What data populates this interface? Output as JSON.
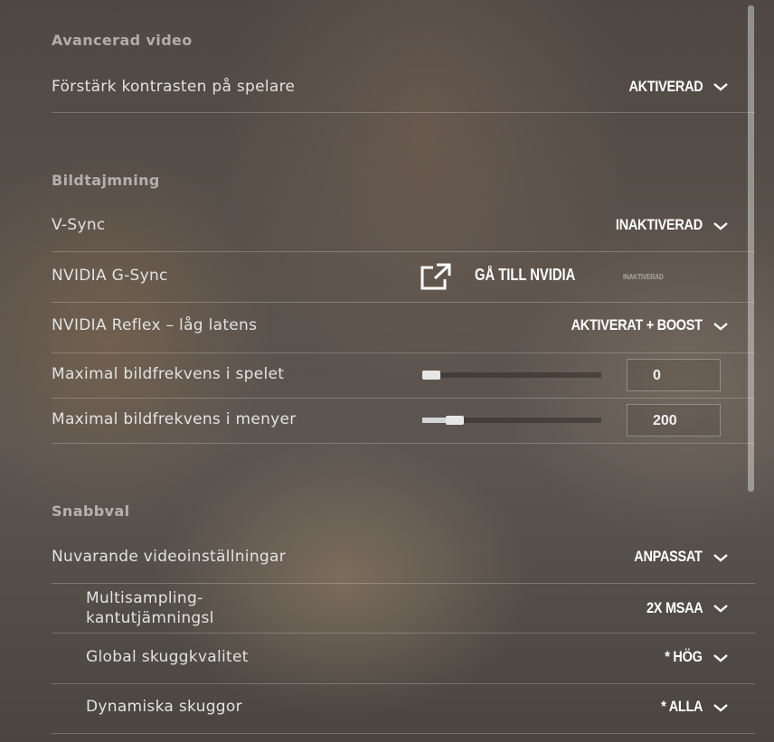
{
  "sections": {
    "advanced_video": "Avancerad video",
    "frame_timing": "Bildtajmning",
    "quick_select": "Snabbval"
  },
  "rows": {
    "contrast": {
      "label": "Förstärk kontrasten på spelare",
      "value": "AKTIVERAD"
    },
    "vsync": {
      "label": "V-Sync",
      "value": "INAKTIVERAD"
    },
    "gsync": {
      "label": "NVIDIA G-Sync",
      "link": "GÅ TILL NVIDIA",
      "status": "INAKTIVERAD"
    },
    "reflex": {
      "label": "NVIDIA Reflex – låg latens",
      "value": "AKTIVERAT + BOOST"
    },
    "max_fps_game": {
      "label": "Maximal bildfrekvens i spelet",
      "value": "0",
      "slider_fraction": 0.0
    },
    "max_fps_menu": {
      "label": "Maximal bildfrekvens i menyer",
      "value": "200",
      "slider_fraction": 0.2
    },
    "current_video": {
      "label": "Nuvarande videoinställningar",
      "value": "ANPASSAT"
    },
    "msaa": {
      "label_line1": "Multisampling-",
      "label_line2": "kantutjämningsl",
      "value": "2X MSAA"
    },
    "shadow_quality": {
      "label": "Global skuggkvalitet",
      "value": "* HÖG"
    },
    "dynamic_shadows": {
      "label": "Dynamiska skuggor",
      "value": "* ALLA"
    }
  },
  "icons": {
    "dropdown": "chevron-down-icon",
    "external": "external-link-icon"
  }
}
